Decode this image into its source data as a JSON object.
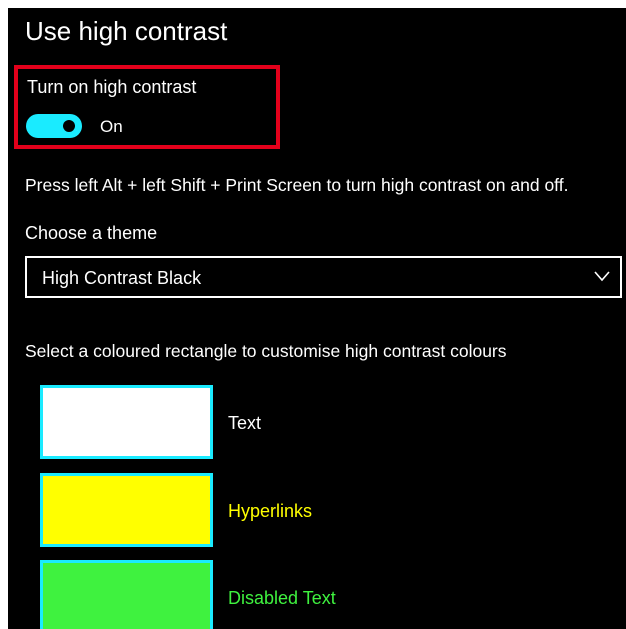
{
  "page": {
    "title": "Use high contrast"
  },
  "toggle": {
    "label": "Turn on high contrast",
    "state": "On",
    "on": true,
    "track_color": "#1aebff"
  },
  "shortcut": {
    "text": "Press left Alt + left Shift + Print Screen to turn high contrast on and off."
  },
  "theme": {
    "label": "Choose a theme",
    "selected": "High Contrast Black",
    "icon": "chevron-down-icon"
  },
  "colours": {
    "label": "Select a coloured rectangle to customise high contrast colours",
    "border_color": "#1aebff",
    "items": [
      {
        "label": "Text",
        "swatch_color": "#ffffff",
        "label_color": "#ffffff"
      },
      {
        "label": "Hyperlinks",
        "swatch_color": "#ffff00",
        "label_color": "#ffff00"
      },
      {
        "label": "Disabled Text",
        "swatch_color": "#3ff23f",
        "label_color": "#3ff23f"
      }
    ]
  },
  "highlight": {
    "color": "#e3001b"
  }
}
